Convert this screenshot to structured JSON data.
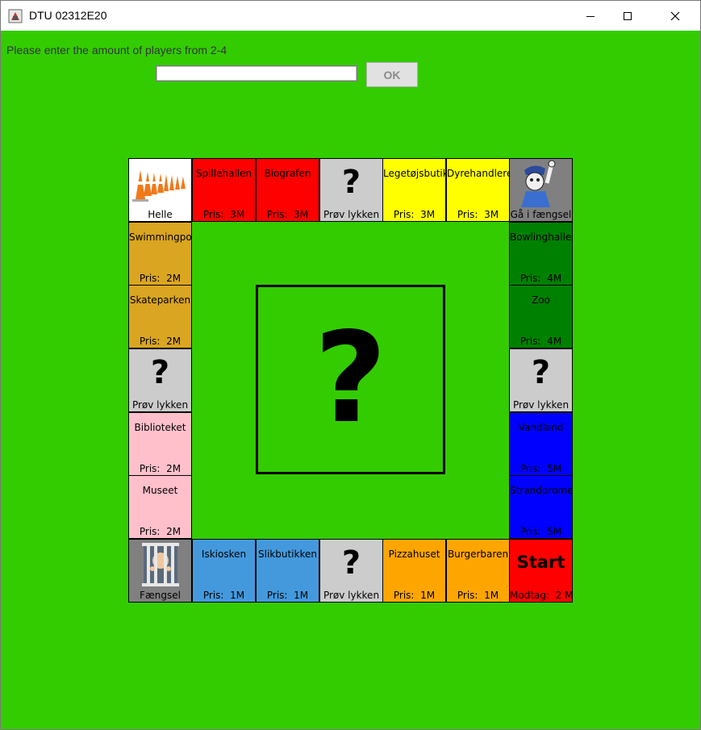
{
  "window": {
    "title": "DTU 02312E20"
  },
  "setup": {
    "prompt": "Please enter the amount of players from 2-4",
    "input_value": "",
    "ok_label": "OK"
  },
  "colors": {
    "background": "#33cc00",
    "red": "#ff0000",
    "yellow": "#ffff00",
    "gray": "#cccccc",
    "mustard": "#daa520",
    "darkgreen": "#008000",
    "blue": "#0000ff",
    "pink": "#ffc0cb",
    "lightblue": "#4499dd",
    "orange": "#ffa500",
    "white": "#ffffff",
    "darkgray": "#808080"
  },
  "board": {
    "center_symbol": "?",
    "fields": {
      "helle": {
        "name": "Helle"
      },
      "spillehallen": {
        "name": "Spillehallen",
        "price": "Pris:  3M"
      },
      "biografen": {
        "name": "Biografen",
        "price": "Pris:  3M"
      },
      "chance_top": {
        "symbol": "?",
        "name": "Prøv lykken"
      },
      "legetojsbutik": {
        "name": "Legetøjsbutik",
        "price": "Pris:  3M"
      },
      "dyrehandlere": {
        "name": "Dyrehandlere",
        "price": "Pris:  3M"
      },
      "ga_i_faengsel": {
        "name": "Gå i fængsel"
      },
      "swimmingpool": {
        "name": "Swimmingpool",
        "price": "Pris:  2M"
      },
      "skateparken": {
        "name": "Skateparken",
        "price": "Pris:  2M"
      },
      "chance_left": {
        "symbol": "?",
        "name": "Prøv lykken"
      },
      "biblioteket": {
        "name": "Biblioteket",
        "price": "Pris:  2M"
      },
      "museet": {
        "name": "Museet",
        "price": "Pris:  2M"
      },
      "bowlinghallen": {
        "name": "Bowlinghallen",
        "price": "Pris:  4M"
      },
      "zoo": {
        "name": "Zoo",
        "price": "Pris:  4M"
      },
      "chance_right": {
        "symbol": "?",
        "name": "Prøv lykken"
      },
      "vandland": {
        "name": "Vandland",
        "price": "Pris:  5M"
      },
      "strandpromenaden": {
        "name": "Strandpromenaden",
        "price": "Pris:  5M"
      },
      "faengsel": {
        "name": "Fængsel"
      },
      "iskiosken": {
        "name": "Iskiosken",
        "price": "Pris:  1M"
      },
      "slikbutikken": {
        "name": "Slikbutikken",
        "price": "Pris:  1M"
      },
      "chance_bottom": {
        "symbol": "?",
        "name": "Prøv lykken"
      },
      "pizzahuset": {
        "name": "Pizzahuset",
        "price": "Pris:  1M"
      },
      "burgerbaren": {
        "name": "Burgerbaren",
        "price": "Pris:  1M"
      },
      "start": {
        "name": "Start",
        "price": "Modtag:  2 M"
      }
    }
  }
}
